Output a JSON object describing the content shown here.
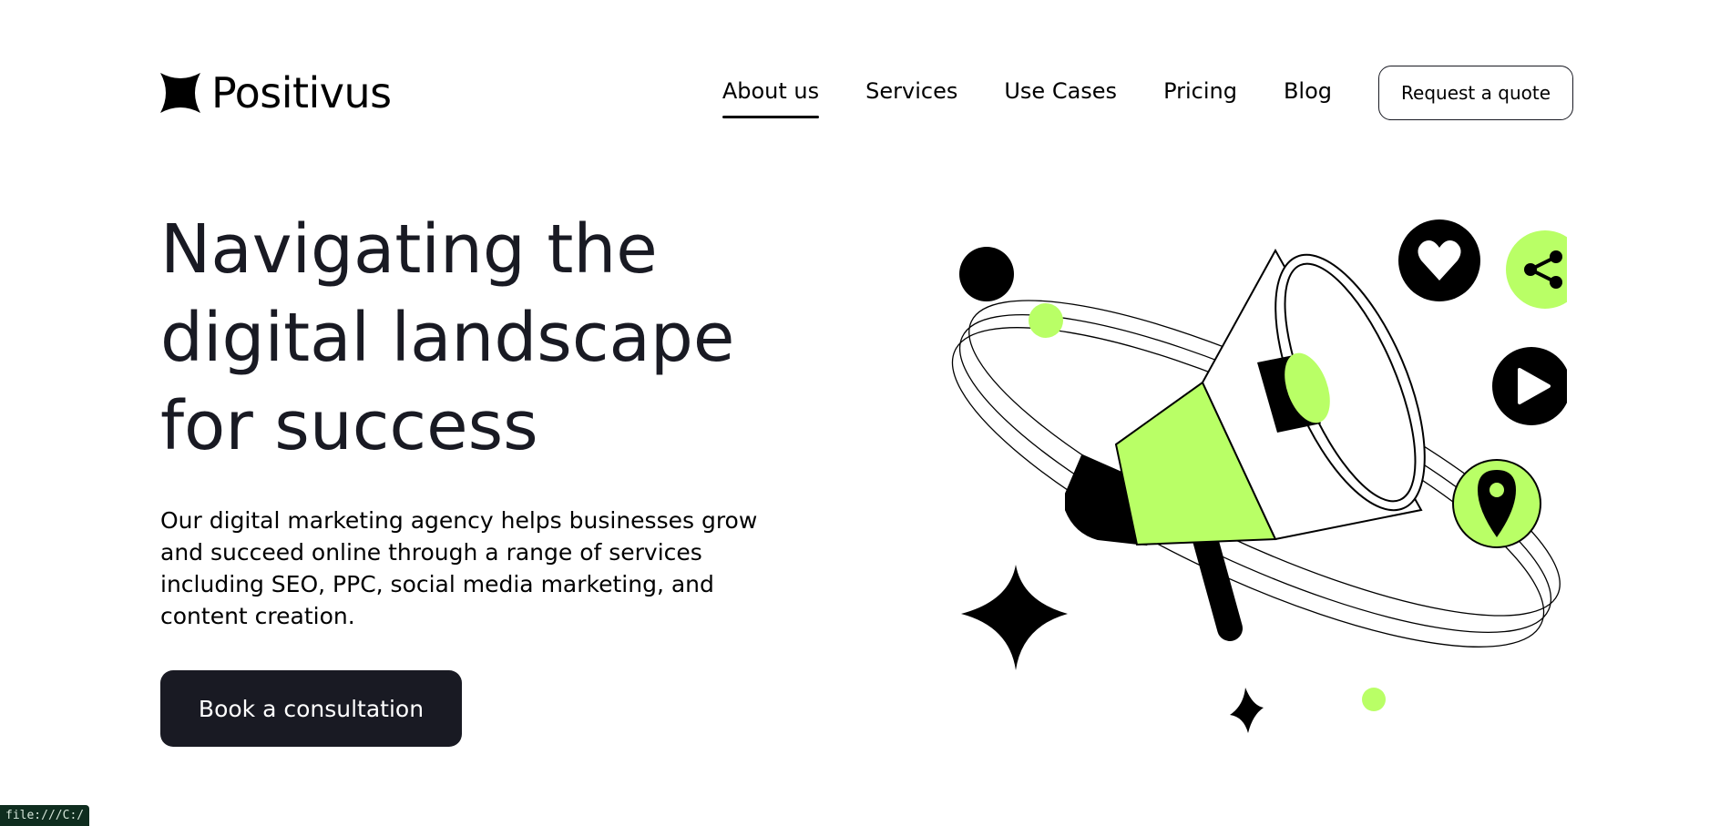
{
  "brand": {
    "name": "Positivus",
    "icon": "star-logo-icon"
  },
  "nav": {
    "items": [
      {
        "label": "About us",
        "active": true
      },
      {
        "label": "Services",
        "active": false
      },
      {
        "label": "Use Cases",
        "active": false
      },
      {
        "label": "Pricing",
        "active": false
      },
      {
        "label": "Blog",
        "active": false
      }
    ],
    "cta_label": "Request a quote"
  },
  "hero": {
    "title_lines": [
      "Navigating the",
      "digital landscape",
      "for success"
    ],
    "description": "Our digital marketing agency helps businesses grow and succeed online through a range of services including SEO, PPC, social media marketing, and content creation.",
    "cta_label": "Book a consultation"
  },
  "illustration": {
    "icons": [
      "megaphone-icon",
      "heart-icon",
      "share-icon",
      "play-icon",
      "location-pin-icon",
      "sparkle-star-icon"
    ]
  },
  "status_bar": {
    "text": "file:///C:/"
  },
  "colors": {
    "accent": "#B9FF66",
    "dark": "#191A23",
    "background": "#FFFFFF"
  }
}
